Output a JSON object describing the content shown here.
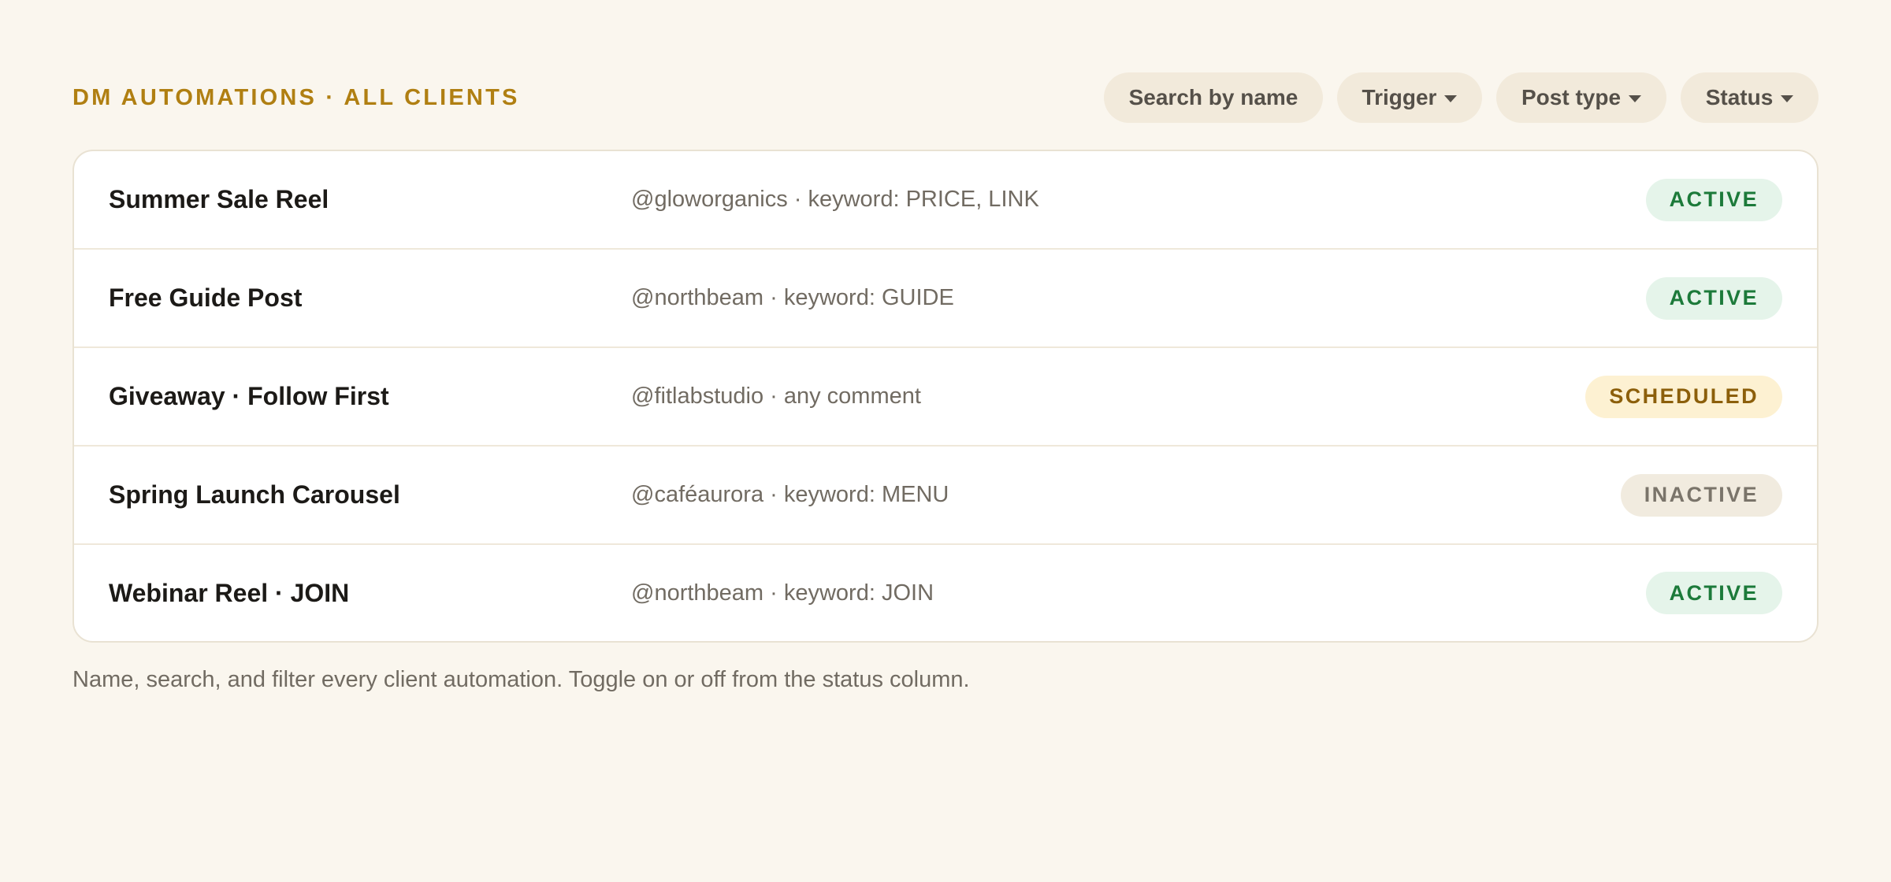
{
  "header": {
    "title": "DM AUTOMATIONS · ALL CLIENTS"
  },
  "filters": {
    "search_label": "Search by name",
    "trigger_label": "Trigger",
    "post_type_label": "Post type",
    "status_label": "Status",
    "dropdown_icon": "chevron-down-icon"
  },
  "automations": [
    {
      "name": "Summer Sale Reel",
      "meta": "@gloworganics · keyword: PRICE, LINK",
      "status": "ACTIVE"
    },
    {
      "name": "Free Guide Post",
      "meta": "@northbeam · keyword: GUIDE",
      "status": "ACTIVE"
    },
    {
      "name": "Giveaway · Follow First",
      "meta": "@fitlabstudio · any comment",
      "status": "SCHEDULED"
    },
    {
      "name": "Spring Launch Carousel",
      "meta": "@caféaurora · keyword: MENU",
      "status": "INACTIVE"
    },
    {
      "name": "Webinar Reel · JOIN",
      "meta": "@northbeam · keyword: JOIN",
      "status": "ACTIVE"
    }
  ],
  "footnote": "Name, search, and filter every client automation. Toggle on or off from the status column.",
  "colors": {
    "background": "#faf6ee",
    "title_accent": "#b07f12",
    "active_text": "#1c7a3a",
    "active_bg": "#e5f4ea",
    "scheduled_text": "#8c5f0b",
    "scheduled_bg": "#fdf1d2",
    "inactive_text": "#7a746a",
    "inactive_bg": "#f1ebdf"
  }
}
